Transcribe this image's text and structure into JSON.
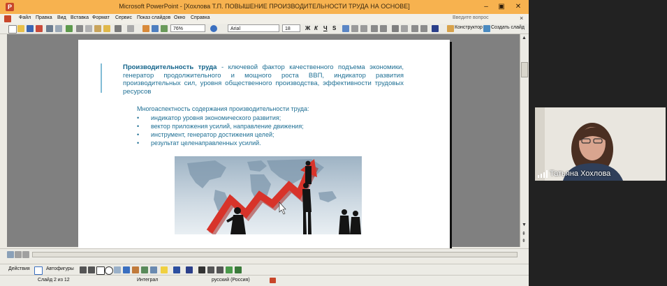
{
  "window": {
    "title": "Microsoft PowerPoint - [Хохлова Т.П. ПОВЫШЕНИЕ ПРОИЗВОДИТЕЛЬНОСТИ ТРУДА НА ОСНОВЕ]"
  },
  "menu": {
    "items": [
      "Файл",
      "Правка",
      "Вид",
      "Вставка",
      "Формат",
      "Сервис",
      "Показ слайдов",
      "Окно",
      "Справка"
    ],
    "help_placeholder": "Введите вопрос"
  },
  "toolbar": {
    "zoom": "76%",
    "font": "Arial",
    "font_size": "18",
    "bold": "Ж",
    "italic": "К",
    "underline": "Ч",
    "shadow": "S",
    "designer_label": "Конструктор",
    "new_slide_label": "Создать слайд"
  },
  "slide": {
    "paragraph_bold": "Производительность труда",
    "paragraph_rest": " - ключевой фактор качественного подъема экономики, генератор продолжительного и мощного роста ВВП, индикатор развития производительных сил, уровня общественного производства, эффективности трудовых ресурсов",
    "subheading": "Многоаспектность содержания производительности труда:",
    "bullets": [
      "индикатор уровня экономического развития;",
      "вектор приложения усилий, направление движения;",
      "инструмент, генератор достижения целей;",
      "результат целенаправленных усилий."
    ]
  },
  "drawing_toolbar": {
    "actions_label": "Действия",
    "autoshapes_label": "Автофигуры"
  },
  "status": {
    "slide": "Слайд 2 из 12",
    "design": "Интеграл",
    "language": "русский (Россия)"
  },
  "video": {
    "participant_name": "Татьяна Хохлова"
  },
  "colors": {
    "titlebar": "#f7b24f",
    "slide_text": "#1e6f94",
    "arrow_red": "#d8332a"
  }
}
